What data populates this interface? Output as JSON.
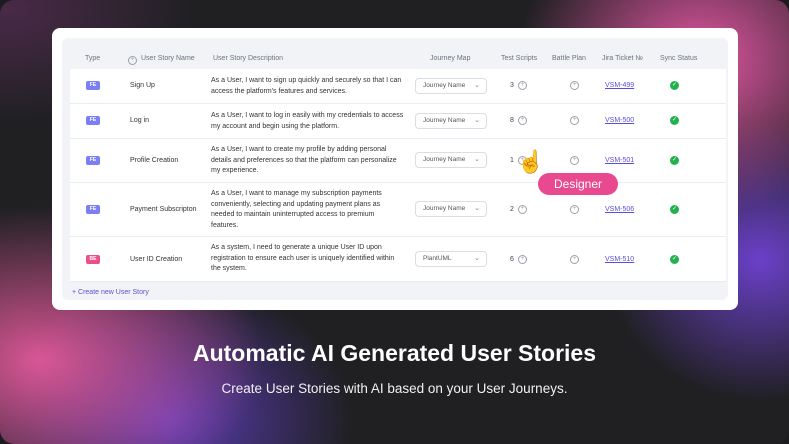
{
  "table": {
    "headers": {
      "type": "Type",
      "name": "User Story Name",
      "description": "User Story Description",
      "journey": "Journey Map",
      "tests": "Test Scripts",
      "battle": "Battle Plan",
      "jira": "Jira Ticket №",
      "sync": "Sync Status"
    },
    "rows": [
      {
        "type": "FE",
        "type_color": "#7b7ff2",
        "name": "Sign Up",
        "desc_lines": [
          "As a User, I want to sign up quickly and securely so that I can",
          "access the platform's features and services."
        ],
        "journey": "Journey Name",
        "tests": "3",
        "jira": "VSM-499"
      },
      {
        "type": "FE",
        "type_color": "#7b7ff2",
        "name": "Log in",
        "desc_lines": [
          "As a User, I want to log in easily with my credentials to access",
          "my account and begin using the platform."
        ],
        "journey": "Journey Name",
        "tests": "8",
        "jira": "VSM-500"
      },
      {
        "type": "FE",
        "type_color": "#7b7ff2",
        "name": "Profile Creation",
        "desc_lines": [
          "As a User, I want to create my profile by adding personal",
          "details and preferences so that the platform can personalize",
          "my experience."
        ],
        "journey": "Journey Name",
        "tests": "1",
        "jira": "VSM-501"
      },
      {
        "type": "FE",
        "type_color": "#7b7ff2",
        "name": "Payment Subscripton",
        "desc_lines": [
          "As a User, I want to manage my subscription payments",
          "conveniently, selecting and updating payment plans as",
          "needed to maintain uninterrupted access to premium",
          "features."
        ],
        "journey": "Journey Name",
        "tests": "2",
        "jira": "VSM-506"
      },
      {
        "type": "BE",
        "type_color": "#ea4f8c",
        "name": "User ID Creation",
        "desc_lines": [
          "As a system, I need to generate a unique User ID upon",
          "registration to ensure each user is uniquely identified within",
          "the system."
        ],
        "journey": "PlantUML",
        "tests": "6",
        "jira": "VSM-510"
      }
    ],
    "create_label": "+ Create new User Story"
  },
  "tooltip": "Designer",
  "marketing": {
    "title": "Automatic AI Generated User Stories",
    "subtitle": "Create User Stories with AI based on your User Journeys."
  },
  "colors": {
    "accent": "#5b4fd6",
    "success": "#22b14c",
    "tooltip": "#e94a8f"
  }
}
